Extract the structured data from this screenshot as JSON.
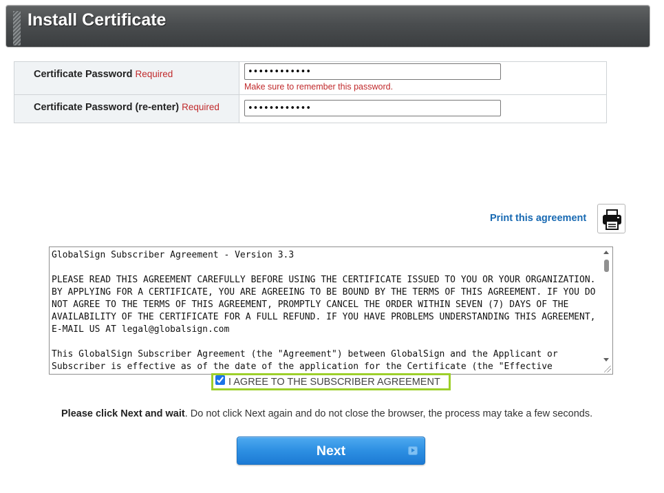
{
  "header": {
    "title": "Install Certificate"
  },
  "form": {
    "password": {
      "label": "Certificate Password",
      "required": "Required",
      "value": "••••••••••••",
      "hint": "Make sure to remember this password."
    },
    "password_confirm": {
      "label": "Certificate Password (re-enter)",
      "required": "Required",
      "value": "••••••••••••"
    }
  },
  "print": {
    "link_label": "Print this agreement",
    "icon": "printer-icon"
  },
  "agreement": {
    "text": "GlobalSign Subscriber Agreement - Version 3.3\n\nPLEASE READ THIS AGREEMENT CAREFULLY BEFORE USING THE CERTIFICATE ISSUED TO YOU OR YOUR ORGANIZATION. BY APPLYING FOR A CERTIFICATE, YOU ARE AGREEING TO BE BOUND BY THE TERMS OF THIS AGREEMENT. IF YOU DO NOT AGREE TO THE TERMS OF THIS AGREEMENT, PROMPTLY CANCEL THE ORDER WITHIN SEVEN (7) DAYS OF THE AVAILABILITY OF THE CERTIFICATE FOR A FULL REFUND. IF YOU HAVE PROBLEMS UNDERSTANDING THIS AGREEMENT, E-MAIL US AT legal@globalsign.com\n\nThis GlobalSign Subscriber Agreement (the \"Agreement\") between GlobalSign and the Applicant or Subscriber is effective as of the date of the application for the Certificate (the \"Effective"
  },
  "agree": {
    "label": "I AGREE TO THE SUBSCRIBER AGREEMENT",
    "checked": true
  },
  "instruction": {
    "bold": "Please click Next and wait",
    "rest": ". Do not click Next again and do not close the browser, the process may take a few seconds."
  },
  "next_button": {
    "label": "Next"
  },
  "colors": {
    "header_bg": "#4a4d4f",
    "required_red": "#c0292b",
    "link_blue": "#1769b2",
    "agree_highlight": "#9dcf2a",
    "button_blue": "#2d8fe2"
  }
}
